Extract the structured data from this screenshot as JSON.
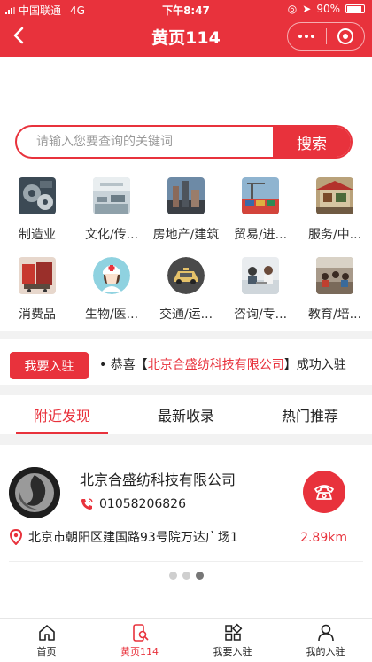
{
  "status_bar": {
    "carrier": "中国联通",
    "network": "4G",
    "time": "下午8:47",
    "battery": "90%"
  },
  "nav": {
    "title": "黄页114"
  },
  "search": {
    "placeholder": "请输入您要查询的关键词",
    "button_label": "搜索"
  },
  "categories": [
    {
      "label": "制造业",
      "icon": "gears-photo-icon"
    },
    {
      "label": "文化/传...",
      "icon": "office-photo-icon"
    },
    {
      "label": "房地产/建筑",
      "icon": "city-photo-icon"
    },
    {
      "label": "贸易/进...",
      "icon": "port-photo-icon"
    },
    {
      "label": "服务/中...",
      "icon": "stall-photo-icon"
    },
    {
      "label": "消费品",
      "icon": "shopping-photo-icon"
    },
    {
      "label": "生物/医...",
      "icon": "nurse-icon"
    },
    {
      "label": "交通/运...",
      "icon": "taxi-icon"
    },
    {
      "label": "咨询/专...",
      "icon": "meeting-photo-icon"
    },
    {
      "label": "教育/培...",
      "icon": "classroom-photo-icon"
    }
  ],
  "join": {
    "button_label": "我要入驻",
    "ticker_prefix": "• 恭喜【",
    "ticker_company": "北京合盛纺科技有限公司",
    "ticker_suffix": "】成功入驻"
  },
  "tabs": [
    {
      "label": "附近发现",
      "active": true
    },
    {
      "label": "最新收录",
      "active": false
    },
    {
      "label": "热门推荐",
      "active": false
    }
  ],
  "listing": {
    "company": "北京合盛纺科技有限公司",
    "phone": "01058206826",
    "address": "北京市朝阳区建国路93号院万达广场1",
    "distance": "2.89km"
  },
  "pager": {
    "count": 3,
    "active_index": 2
  },
  "tabbar": [
    {
      "label": "首页",
      "icon": "home-icon",
      "active": false
    },
    {
      "label": "黄页114",
      "icon": "phone-search-icon",
      "active": true
    },
    {
      "label": "我要入驻",
      "icon": "grid-icon",
      "active": false
    },
    {
      "label": "我的入驻",
      "icon": "user-icon",
      "active": false
    }
  ],
  "colors": {
    "accent": "#e8323c"
  }
}
